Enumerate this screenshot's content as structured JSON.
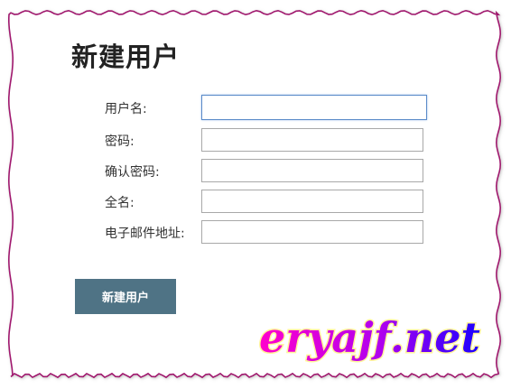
{
  "page": {
    "title": "新建用户"
  },
  "form": {
    "fields": [
      {
        "label": "用户名:",
        "value": "",
        "focused": true
      },
      {
        "label": "密码:",
        "value": ""
      },
      {
        "label": "确认密码:",
        "value": ""
      },
      {
        "label": "全名:",
        "value": ""
      },
      {
        "label": "电子邮件地址:",
        "value": ""
      }
    ],
    "submit_label": "新建用户"
  },
  "watermark": {
    "text": "eryajf.net"
  },
  "colors": {
    "button_bg": "#4f7385",
    "border_wavy": "#a0186e",
    "focus_border": "#5b8bc9",
    "watermark_fill_start": "#ff00cc",
    "watermark_fill_end": "#1a00ff"
  }
}
